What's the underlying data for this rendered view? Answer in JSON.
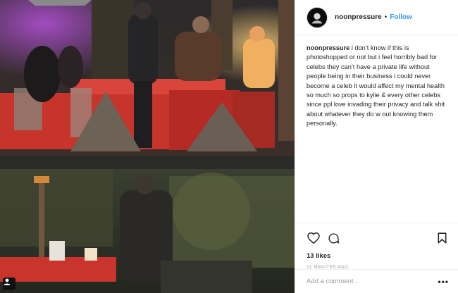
{
  "post": {
    "username": "noonpressure",
    "separator": "•",
    "follow_label": "Follow",
    "caption_user": "noonpressure",
    "caption_text": "i don’t know if this is photoshopped or not but i feel horribly bad for celebs they can’t have a private life without people being in their business i could never become a celeb it would affect my mental health so much so props to kylie & every other celebs since ppl love invading their privacy and talk shit about whatever they do w out knowing them personally.",
    "likes": "13 likes",
    "time_ago": "21 MINUTES AGO",
    "comment_placeholder": "Add a comment...",
    "more_label": "•••"
  },
  "icons": {
    "like": "heart-icon",
    "comment": "comment-icon",
    "save": "bookmark-icon",
    "media_badge": "user-tag-icon"
  },
  "colors": {
    "follow": "#3897f0",
    "text": "#262626",
    "muted": "#999999",
    "border": "#efefef"
  }
}
